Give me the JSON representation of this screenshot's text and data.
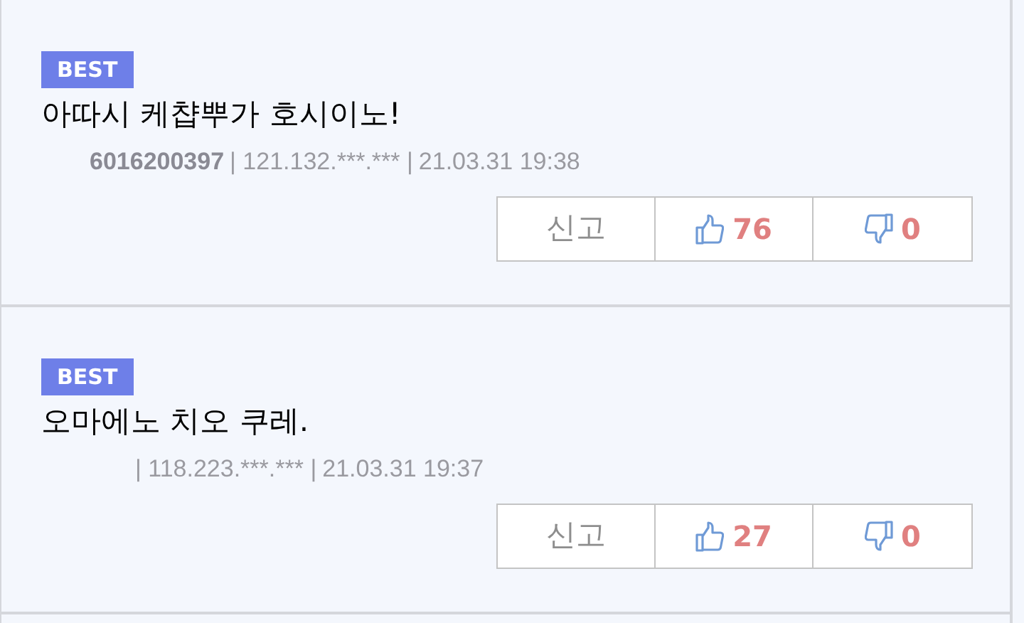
{
  "comments": [
    {
      "badge": "BEST",
      "text": "아따시 케챱뿌가 호시이노!",
      "author": "6016200397",
      "ip": "| 121.132.***.*** |",
      "date": "21.03.31 19:38",
      "report": "신고",
      "likes": "76",
      "dislikes": "0"
    },
    {
      "badge": "BEST",
      "text": "오마에노 치오 쿠레.",
      "ip": "| 118.223.***.*** |",
      "date": "21.03.31 19:37",
      "report": "신고",
      "likes": "27",
      "dislikes": "0"
    }
  ]
}
